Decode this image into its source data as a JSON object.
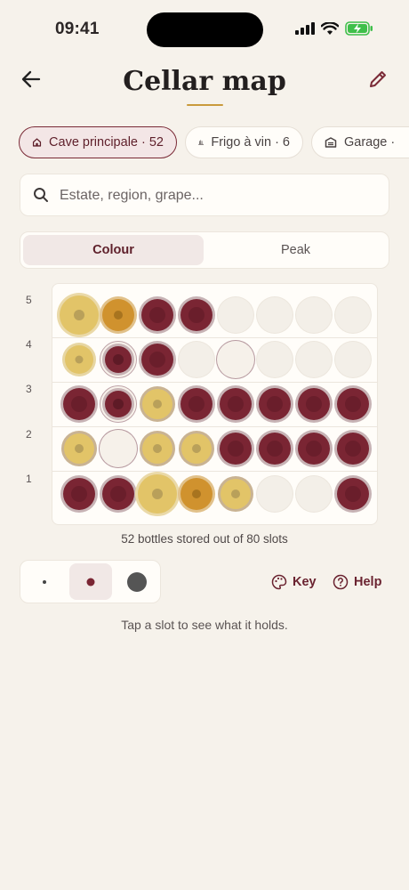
{
  "status_bar": {
    "time": "09:41"
  },
  "header": {
    "title": "Cellar map"
  },
  "locations": [
    {
      "label": "Cave principale · 52",
      "active": true
    },
    {
      "label": "Frigo à vin · 6",
      "active": false
    },
    {
      "label": "Garage ·",
      "active": false
    }
  ],
  "search": {
    "placeholder": "Estate, region, grape..."
  },
  "view_mode": {
    "options": [
      "Colour",
      "Peak"
    ],
    "selected": "Colour"
  },
  "grid": {
    "row_labels": [
      "5",
      "4",
      "3",
      "2",
      "1"
    ],
    "columns": 8,
    "rows": [
      [
        "white-large",
        "orange",
        "red",
        "red",
        "empty",
        "empty",
        "empty",
        "empty"
      ],
      [
        "white-small",
        "red-small",
        "red",
        "empty",
        "empty-ring",
        "empty",
        "empty",
        "empty"
      ],
      [
        "red",
        "red-small",
        "white",
        "red",
        "red",
        "red",
        "red",
        "red"
      ],
      [
        "white",
        "empty-ring",
        "white",
        "white",
        "red",
        "red",
        "red",
        "red"
      ],
      [
        "red",
        "red",
        "white-large",
        "orange",
        "white",
        "empty",
        "empty",
        "red"
      ]
    ]
  },
  "colors": {
    "red": "#7a2533",
    "white": "#e2c468",
    "orange": "#d0922e",
    "accent": "#7a2a36",
    "gold_underline": "#c99a3c"
  },
  "summary": "52 bottles stored out of 80 slots",
  "size_options": {
    "options": [
      "small",
      "medium",
      "large"
    ],
    "selected": "medium"
  },
  "actions": {
    "key_label": "Key",
    "help_label": "Help"
  },
  "hint": "Tap a slot to see what it holds."
}
